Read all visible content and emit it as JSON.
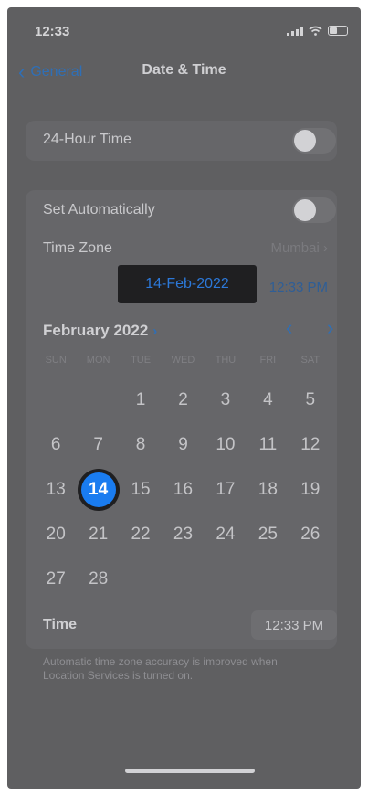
{
  "status_bar": {
    "time": "12:33",
    "icons": [
      "signal-icon",
      "wifi-icon",
      "battery-icon"
    ]
  },
  "nav": {
    "back_label": "General",
    "title": "Date & Time"
  },
  "hour24": {
    "label": "24-Hour Time",
    "on": false
  },
  "auto": {
    "label": "Set Automatically",
    "on": false
  },
  "timezone": {
    "label": "Time Zone",
    "value": "Mumbai",
    "chevron": "›"
  },
  "selected": {
    "date": "14-Feb-2022",
    "time": "12:33 PM"
  },
  "calendar": {
    "month_label": "February 2022",
    "month_chevron": "›",
    "prev_arrow": "‹",
    "next_arrow": "›",
    "weekdays": [
      "SUN",
      "MON",
      "TUE",
      "WED",
      "THU",
      "FRI",
      "SAT"
    ],
    "cells": [
      "",
      "",
      "1",
      "2",
      "3",
      "4",
      "5",
      "6",
      "7",
      "8",
      "9",
      "10",
      "11",
      "12",
      "13",
      "14",
      "15",
      "16",
      "17",
      "18",
      "19",
      "20",
      "21",
      "22",
      "23",
      "24",
      "25",
      "26",
      "27",
      "28",
      "",
      "",
      "",
      "",
      ""
    ],
    "selected_day": "14"
  },
  "time_row": {
    "label": "Time",
    "value": "12:33 PM"
  },
  "footnote": "Automatic time zone accuracy is improved when Location Services is turned on.",
  "colors": {
    "accent": "#1a7cf0",
    "background": "#5f5f61",
    "card": "#666669"
  }
}
